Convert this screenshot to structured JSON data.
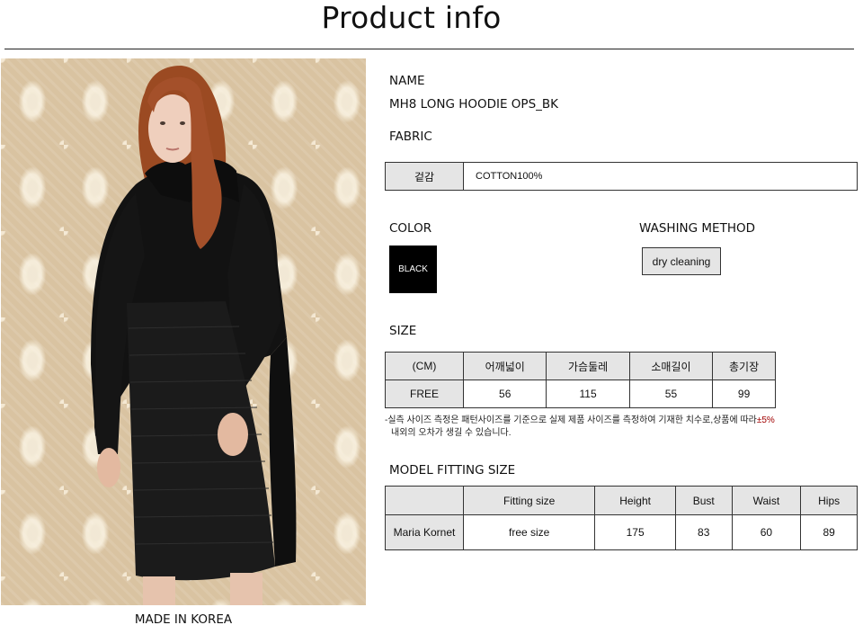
{
  "header": {
    "title": "Product info"
  },
  "photo": {
    "caption": "MADE IN KOREA"
  },
  "name": {
    "label": "NAME",
    "value": "MH8 LONG HOODIE OPS_BK"
  },
  "fabric": {
    "label": "FABRIC",
    "key": "겉감",
    "value": "COTTON100%"
  },
  "color": {
    "label": "COLOR",
    "swatch_text": "BLACK",
    "swatch_hex": "#000000"
  },
  "washing": {
    "label": "WASHING METHOD",
    "value": "dry cleaning"
  },
  "size": {
    "label": "SIZE",
    "headers": [
      "(CM)",
      "어깨넓이",
      "가슴둘레",
      "소매길이",
      "총기장"
    ],
    "rows": [
      [
        "FREE",
        "56",
        "115",
        "55",
        "99"
      ]
    ],
    "note_line1": "-실측 사이즈 측정은 패턴사이즈를 기준으로 실제 제품 사이즈를 측정하여 기재한 치수로,상품에 따라",
    "note_tolerance": "±5%",
    "note_line2": "내외의 오차가 생길 수 있습니다."
  },
  "model_fitting": {
    "label": "MODEL FITTING SIZE",
    "headers": [
      "",
      "Fitting size",
      "Height",
      "Bust",
      "Waist",
      "Hips"
    ],
    "rows": [
      [
        "Maria Kornet",
        "free size",
        "175",
        "83",
        "60",
        "89"
      ]
    ]
  },
  "colors": {
    "shade": "#e5e5e5",
    "border": "#333333",
    "wallpaper": "#d9c3a1",
    "tolerance_red": "#a00000"
  }
}
